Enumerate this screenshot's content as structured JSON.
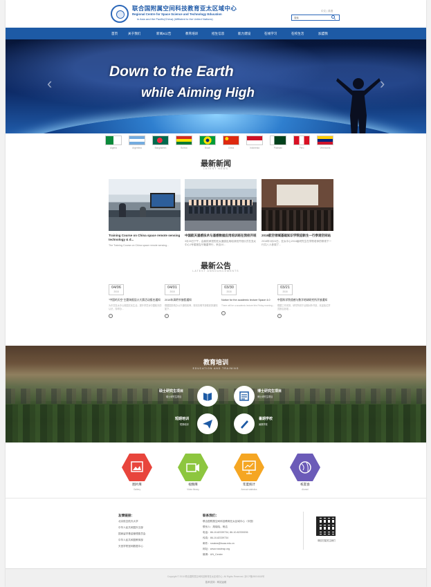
{
  "header": {
    "org_name_cn": "联合国附属空间科技教育亚太区域中心",
    "org_name_en_line1": "Regional Centre for Space Science and Technology Education",
    "org_name_en_line2": "in Asia and the Pacific(China) (Affiliated to the United Nations)",
    "lang_links": "中文 | 英语",
    "search_placeholder": "搜索"
  },
  "nav": {
    "items": [
      "首页",
      "关于我们",
      "新闻&公告",
      "教育培训",
      "招生信息",
      "能力建设",
      "在线学习",
      "在校生活",
      "加盟我"
    ]
  },
  "banner": {
    "line1": "Down to the Earth",
    "line2": "while Aiming High",
    "prev_arrow": "‹",
    "next_arrow": "›"
  },
  "flags": [
    {
      "name": "Algeria",
      "color1": "#0b8a3b",
      "color2": "#ffffff"
    },
    {
      "name": "Argentina",
      "color1": "#74acdf",
      "color2": "#ffffff"
    },
    {
      "name": "Bangladesh",
      "color1": "#006a4e",
      "color2": "#f42a41"
    },
    {
      "name": "Bolivia",
      "color1": "#d52b1e",
      "color2": "#f9e300"
    },
    {
      "name": "Brazil",
      "color1": "#009b3a",
      "color2": "#fedf00"
    },
    {
      "name": "China",
      "color1": "#de2910",
      "color2": "#ffde00"
    },
    {
      "name": "Indonesia",
      "color1": "#ce1126",
      "color2": "#ffffff"
    },
    {
      "name": "Pakistan",
      "color1": "#01411c",
      "color2": "#ffffff"
    },
    {
      "name": "Peru",
      "color1": "#d91023",
      "color2": "#ffffff"
    },
    {
      "name": "Venezuela",
      "color1": "#ffcc00",
      "color2": "#00247d"
    }
  ],
  "news": {
    "title": "最新新闻",
    "subtitle": "LATEST NEWS",
    "items": [
      {
        "title": "Training Course on China space remote sensing technology & d...",
        "desc": "The Training Course on China space remote sensing..."
      },
      {
        "title": "中国航天遥感技术与遥感数据应用培训班在我校开班",
        "desc": "3月26日下午，由我校承担的亚太遥感应用培训班开班仪式在亚太中心1号楼报告厅隆重举行，来自10..."
      },
      {
        "title": "2018航空领域基础知识学院迎新生一行参观空间站",
        "desc": "2018年3月24日，亚太中心2018级研究生在学院老师的带领下一行共八人参观了..."
      }
    ]
  },
  "announcements": {
    "title": "最新公告",
    "subtitle": "LATEST ANNOUNCEMENTS",
    "items": [
      {
        "day": "04/06",
        "year": "2018",
        "title": "\"中国的天空\"主题海报设计大赛活动报名通知",
        "desc": "为丰富亚太中心校园文化生活，提升学员对中国航天的认识，特举办..."
      },
      {
        "day": "04/01",
        "year": "2018",
        "title": "2018年清明节放假通知",
        "desc": "根据国务院办公厅通知精神，现将清明节放假安排通知如下..."
      },
      {
        "day": "03/30",
        "year": "2018",
        "title": "Notice for the academic lecture Space 4.0",
        "desc": "There will be a academic lecture this Friday morning..."
      },
      {
        "day": "03/21",
        "year": "2018",
        "title": "中国科学院遥感与数字地球研究所开放通知",
        "desc": "根据工作安排，研究所将于近期对外开放，欢迎各位学员报名参观..."
      }
    ]
  },
  "education": {
    "title": "教育培训",
    "subtitle": "EDUCATION AND TRAINING",
    "items": [
      {
        "label": "硕士研究生项目",
        "sub": "硕士研究生项目"
      },
      {
        "label": "博士研究生项目",
        "sub": "博士研究生项目"
      },
      {
        "label": "短期培训",
        "sub": "短期培训"
      },
      {
        "label": "暑期学校",
        "sub": "暑期学校"
      }
    ]
  },
  "quick_links": [
    {
      "label": "图片库",
      "sub": "Gallery",
      "color": "#e8453c"
    },
    {
      "label": "视频库",
      "sub": "Video library",
      "color": "#8dc63f"
    },
    {
      "label": "年度统计",
      "sub": "Annual statistics",
      "color": "#f5a623"
    },
    {
      "label": "校友会",
      "sub": "Alumni",
      "color": "#6b5bb8"
    }
  ],
  "footer": {
    "links_title": "友情链接：",
    "links": [
      "北京航空航天大学",
      "中华人民共和国外交部",
      "国家留学基金管理委员会",
      "中华人民共和国教育部",
      "天宫学院官网数据中心"
    ],
    "contact_title": "联系我们：",
    "contact": [
      "联合国附属空间科技教育亚太区域中心（中国）",
      "联系人：胡晓晓，杨洁",
      "电话：86-10-82339734, 86-10-82339206",
      "传真：86-10-82339734",
      "邮件：rcsstea@buaa.edu.cn",
      "网址：www.rcssteap.org",
      "微博：UN_Centre"
    ],
    "qr_label": "微信扫描关注我们",
    "copyright": "Copyright © 2016 联合国附属空间科技教育亚太区域中心. All Rights Reserved. 京ICP备05004618号",
    "bottom_links": "技术支持：网站运维"
  }
}
